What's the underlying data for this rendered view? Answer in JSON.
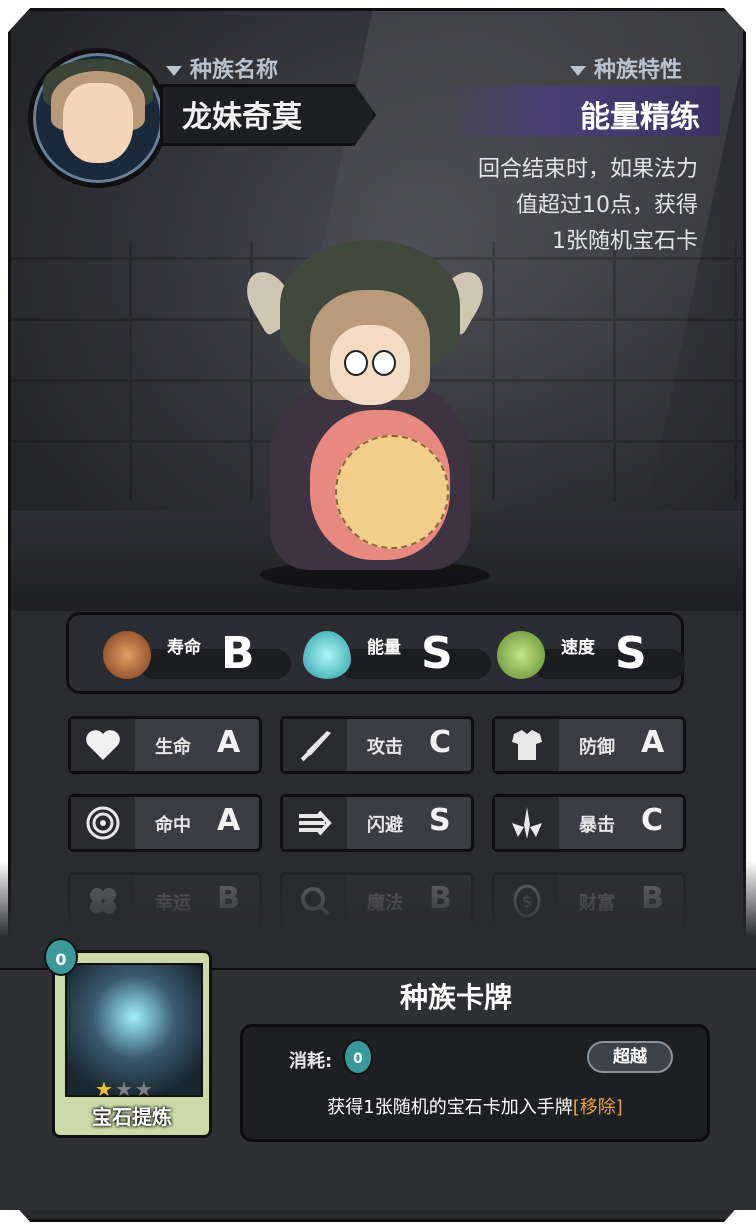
{
  "header": {
    "race_name_label": "种族名称",
    "race_name": "龙妹奇莫",
    "race_trait_label": "种族特性",
    "race_trait": "能量精练",
    "trait_description_lines": [
      "回合结束时，如果法力",
      "值超过10点，获得",
      "1张随机宝石卡"
    ]
  },
  "main_stats": [
    {
      "name": "寿命",
      "grade": "B",
      "icon": "lifespan-icon",
      "color": "#b8763a"
    },
    {
      "name": "能量",
      "grade": "S",
      "icon": "energy-flame-icon",
      "color": "#4fd3d6"
    },
    {
      "name": "速度",
      "grade": "S",
      "icon": "winged-boot-icon",
      "color": "#8fbf4a"
    }
  ],
  "attributes": [
    {
      "name": "生命",
      "grade": "A",
      "icon": "heart-icon"
    },
    {
      "name": "攻击",
      "grade": "C",
      "icon": "sword-icon"
    },
    {
      "name": "防御",
      "grade": "A",
      "icon": "armor-icon"
    },
    {
      "name": "命中",
      "grade": "A",
      "icon": "target-icon"
    },
    {
      "name": "闪避",
      "grade": "S",
      "icon": "dodge-arrows-icon"
    },
    {
      "name": "暴击",
      "grade": "C",
      "icon": "crit-burst-icon"
    },
    {
      "name": "幸运",
      "grade": "B",
      "icon": "clover-icon"
    },
    {
      "name": "魔法",
      "grade": "B",
      "icon": "magic-icon"
    },
    {
      "name": "财富",
      "grade": "B",
      "icon": "coin-icon"
    }
  ],
  "race_card": {
    "section_title": "种族卡牌",
    "card_name": "宝石提炼",
    "cost_value": "0",
    "stars_filled": 1,
    "stars_total": 3,
    "cost_label": "消耗:",
    "tag": "超越",
    "description": "获得1张随机的宝石卡加入手牌",
    "remove_keyword": "[移除]"
  }
}
